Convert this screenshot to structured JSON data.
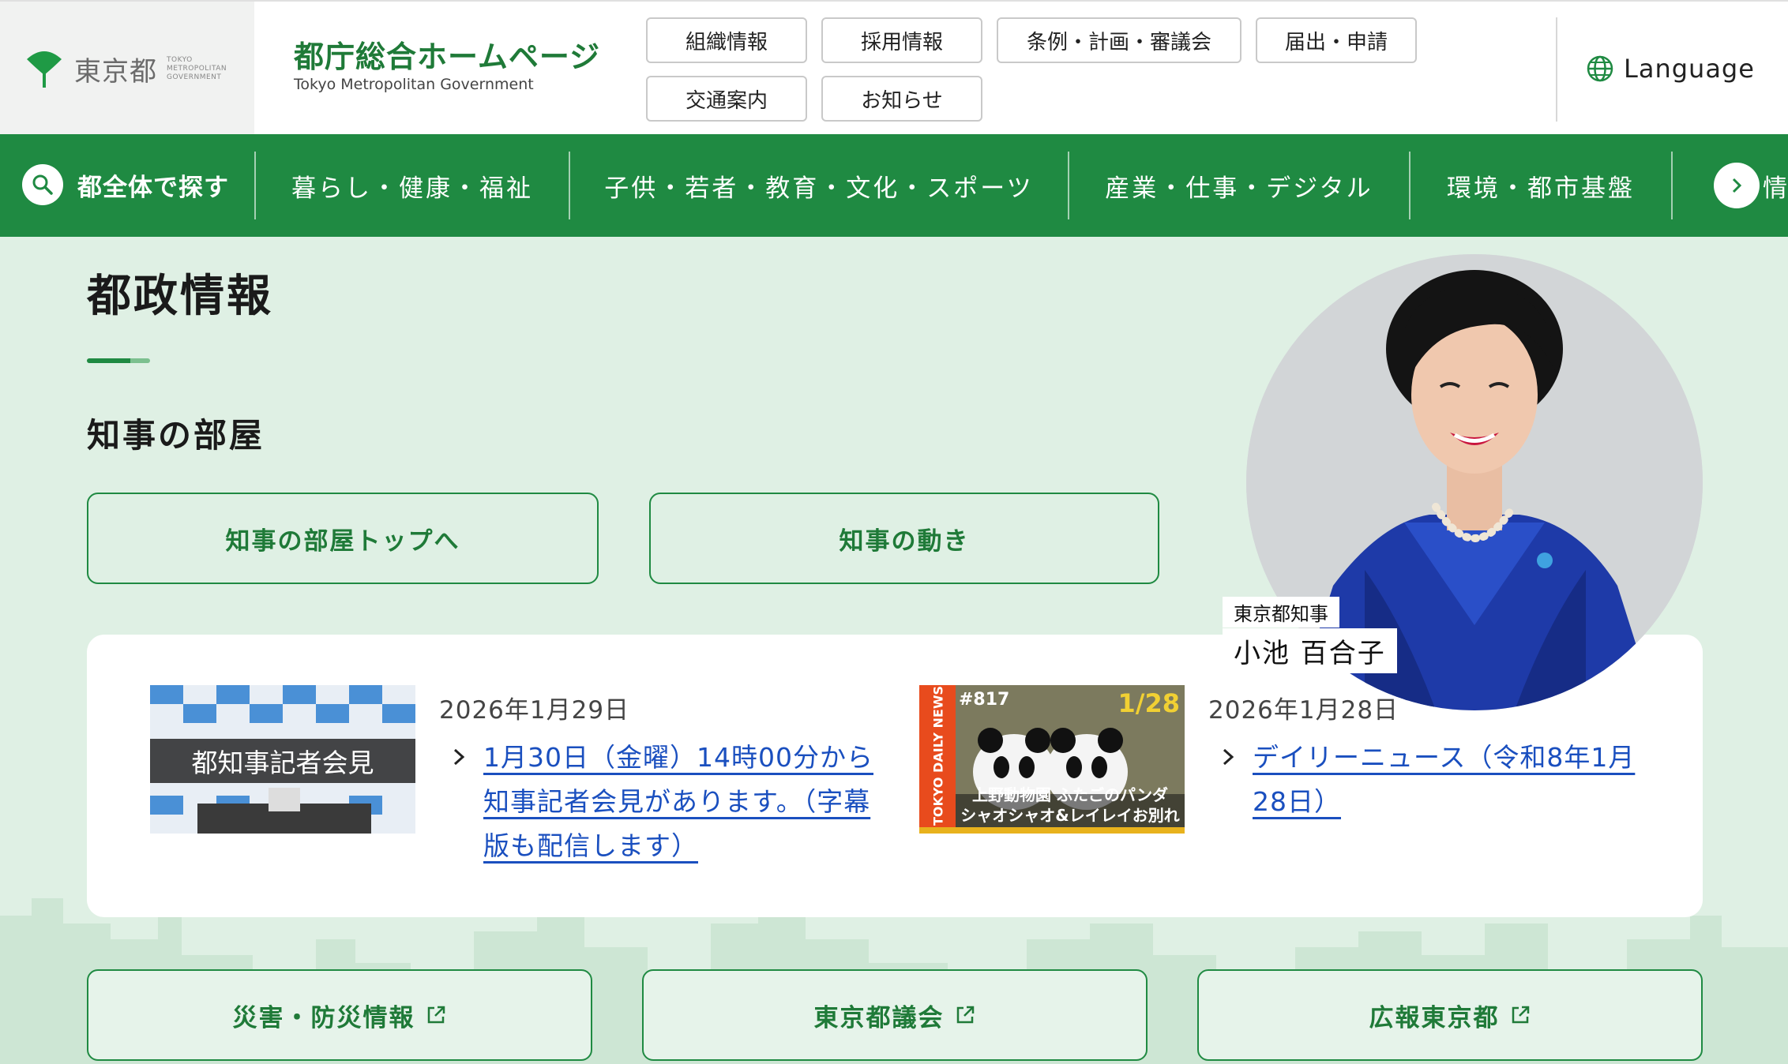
{
  "header": {
    "logo_text": "東京都",
    "logo_sub": [
      "TOKYO",
      "METROPOLITAN",
      "GOVERNMENT"
    ],
    "site_title": "都庁総合ホームページ",
    "site_subtitle": "Tokyo Metropolitan Government",
    "links": [
      {
        "label": "組織情報"
      },
      {
        "label": "採用情報"
      },
      {
        "label": "条例・計画・審議会"
      },
      {
        "label": "届出・申請"
      },
      {
        "label": "交通案内"
      },
      {
        "label": "お知らせ"
      }
    ],
    "language_label": "Language"
  },
  "nav": {
    "search_label": "都全体で探す",
    "items": [
      {
        "label": "暮らし・健康・福祉"
      },
      {
        "label": "子供・若者・教育・文化・スポーツ"
      },
      {
        "label": "産業・仕事・デジタル"
      },
      {
        "label": "環境・都市基盤"
      }
    ],
    "overflow_text": "情"
  },
  "main": {
    "section_title": "都政情報",
    "subsection_title": "知事の部屋",
    "buttons": [
      {
        "label": "知事の部屋トップへ"
      },
      {
        "label": "知事の動き"
      }
    ],
    "governor": {
      "role": "東京都知事",
      "name": "小池 百合子"
    },
    "news": [
      {
        "date": "2026年1月29日",
        "thumb_text": "都知事記者会見",
        "link_lines": [
          "1月30日（金曜）14時00分から",
          "知事記者会見があります。（字幕",
          "版も配信します）"
        ]
      },
      {
        "date": "2026年1月28日",
        "thumb_number": "#817",
        "thumb_date": "1/28",
        "thumb_side": "TOKYO DAILY NEWS",
        "thumb_caption_1": "上野動物園 ふたごのパンダ",
        "thumb_caption_2": "シャオシャオ&レイレイお別れ",
        "link_lines": [
          "デイリーニュース（令和8年1月",
          "28日）"
        ]
      }
    ],
    "bottom_links": [
      {
        "label": "災害・防災情報"
      },
      {
        "label": "東京都議会"
      },
      {
        "label": "広報東京都"
      }
    ]
  },
  "colors": {
    "brand_green": "#1f8a42",
    "background": "#dff0e4",
    "link_blue": "#1a4fbf"
  }
}
